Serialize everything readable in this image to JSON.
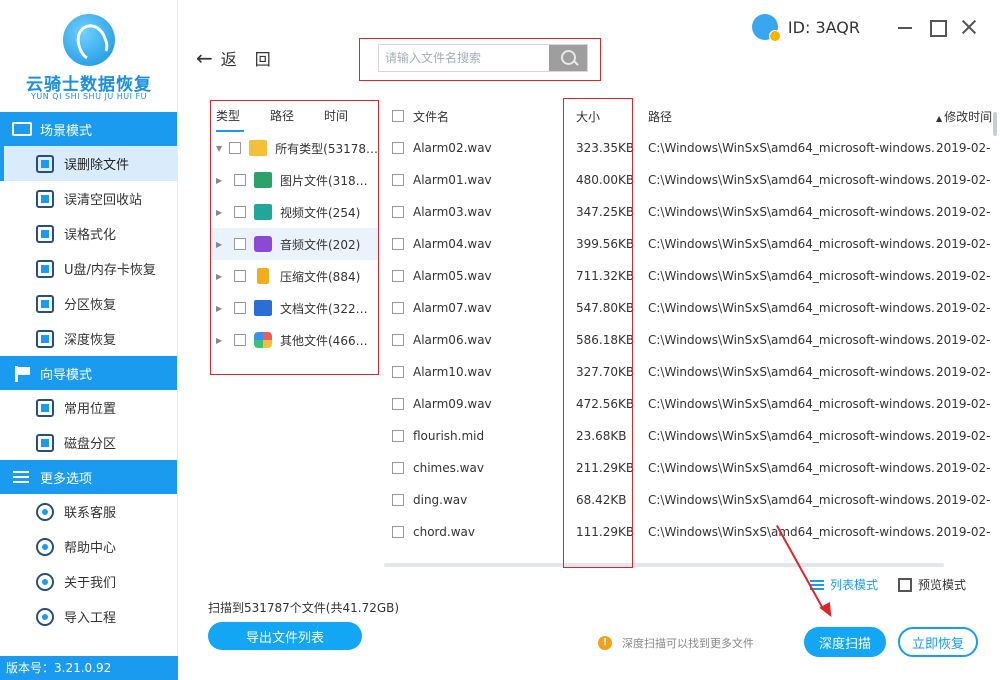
{
  "sidebar": {
    "logo_title": "云骑士数据恢复",
    "logo_sub": "YUN QI SHI SHU JU HUI FU",
    "sections": [
      {
        "title": "场景模式",
        "icon": "scene-icon",
        "items": [
          {
            "label": "误删除文件",
            "icon": "deleted-file-icon",
            "active": true
          },
          {
            "label": "误清空回收站",
            "icon": "recycle-bin-icon"
          },
          {
            "label": "误格式化",
            "icon": "format-icon"
          },
          {
            "label": "U盘/内存卡恢复",
            "icon": "usb-card-icon"
          },
          {
            "label": "分区恢复",
            "icon": "partition-icon"
          },
          {
            "label": "深度恢复",
            "icon": "deep-recover-icon"
          }
        ]
      },
      {
        "title": "向导模式",
        "icon": "guide-flag-icon",
        "items": [
          {
            "label": "常用位置",
            "icon": "common-location-icon"
          },
          {
            "label": "磁盘分区",
            "icon": "disk-partition-icon"
          }
        ]
      },
      {
        "title": "更多选项",
        "icon": "menu-icon",
        "items": [
          {
            "label": "联系客服",
            "icon": "customer-service-icon"
          },
          {
            "label": "帮助中心",
            "icon": "help-icon"
          },
          {
            "label": "关于我们",
            "icon": "info-icon"
          },
          {
            "label": "导入工程",
            "icon": "import-icon"
          }
        ]
      }
    ],
    "version": "版本号：3.21.0.92"
  },
  "topbar": {
    "back_1": "返",
    "back_2": "回",
    "search_placeholder": "请输入文件名搜索",
    "id_text": "ID: 3AQR"
  },
  "tree": {
    "tabs": [
      "类型",
      "路径",
      "时间"
    ],
    "rows": [
      {
        "label": "所有类型(53178…",
        "icon": "folder-icon",
        "cls": "folder",
        "caret": "▼"
      },
      {
        "label": "图片文件(318…",
        "icon": "image-icon",
        "cls": "pic",
        "caret": "▶"
      },
      {
        "label": "视频文件(254)",
        "icon": "video-icon",
        "cls": "video",
        "caret": "▶"
      },
      {
        "label": "音频文件(202)",
        "icon": "audio-icon",
        "cls": "audio",
        "caret": "▶",
        "selected": true
      },
      {
        "label": "压缩文件(884)",
        "icon": "zip-icon",
        "cls": "zip",
        "caret": "▶"
      },
      {
        "label": "文档文件(322…",
        "icon": "document-icon",
        "cls": "doc",
        "caret": "▶"
      },
      {
        "label": "其他文件(466…",
        "icon": "other-files-icon",
        "cls": "other",
        "caret": "▶"
      }
    ]
  },
  "table": {
    "headers": {
      "name": "文件名",
      "size": "大小",
      "path": "路径",
      "time": "修改时间"
    },
    "rows": [
      {
        "name": "Alarm02.wav",
        "size": "323.35KB",
        "path": "C:\\Windows\\WinSxS\\amd64_microsoft-windows...",
        "time": "2019-02-"
      },
      {
        "name": "Alarm01.wav",
        "size": "480.00KB",
        "path": "C:\\Windows\\WinSxS\\amd64_microsoft-windows...",
        "time": "2019-02-"
      },
      {
        "name": "Alarm03.wav",
        "size": "347.25KB",
        "path": "C:\\Windows\\WinSxS\\amd64_microsoft-windows...",
        "time": "2019-02-"
      },
      {
        "name": "Alarm04.wav",
        "size": "399.56KB",
        "path": "C:\\Windows\\WinSxS\\amd64_microsoft-windows...",
        "time": "2019-02-"
      },
      {
        "name": "Alarm05.wav",
        "size": "711.32KB",
        "path": "C:\\Windows\\WinSxS\\amd64_microsoft-windows...",
        "time": "2019-02-"
      },
      {
        "name": "Alarm07.wav",
        "size": "547.80KB",
        "path": "C:\\Windows\\WinSxS\\amd64_microsoft-windows...",
        "time": "2019-02-"
      },
      {
        "name": "Alarm06.wav",
        "size": "586.18KB",
        "path": "C:\\Windows\\WinSxS\\amd64_microsoft-windows...",
        "time": "2019-02-"
      },
      {
        "name": "Alarm10.wav",
        "size": "327.70KB",
        "path": "C:\\Windows\\WinSxS\\amd64_microsoft-windows...",
        "time": "2019-02-"
      },
      {
        "name": "Alarm09.wav",
        "size": "472.56KB",
        "path": "C:\\Windows\\WinSxS\\amd64_microsoft-windows...",
        "time": "2019-02-"
      },
      {
        "name": "flourish.mid",
        "size": "23.68KB",
        "path": "C:\\Windows\\WinSxS\\amd64_microsoft-windows...",
        "time": "2019-02-"
      },
      {
        "name": "chimes.wav",
        "size": "211.29KB",
        "path": "C:\\Windows\\WinSxS\\amd64_microsoft-windows...",
        "time": "2019-02-"
      },
      {
        "name": "ding.wav",
        "size": "68.42KB",
        "path": "C:\\Windows\\WinSxS\\amd64_microsoft-windows...",
        "time": "2019-02-"
      },
      {
        "name": "chord.wav",
        "size": "111.29KB",
        "path": "C:\\Windows\\WinSxS\\amd64_microsoft-windows...",
        "time": "2019-02-"
      }
    ]
  },
  "bottom": {
    "scan_info": "扫描到531787个文件(共41.72GB)",
    "export_label": "导出文件列表",
    "list_mode": "列表模式",
    "preview_mode": "预览模式",
    "tip": "深度扫描可以找到更多文件",
    "deep_scan": "深度扫描",
    "recover_now": "立即恢复"
  },
  "colors": {
    "accent": "#1a9bf0",
    "highlight": "#e0242a"
  }
}
